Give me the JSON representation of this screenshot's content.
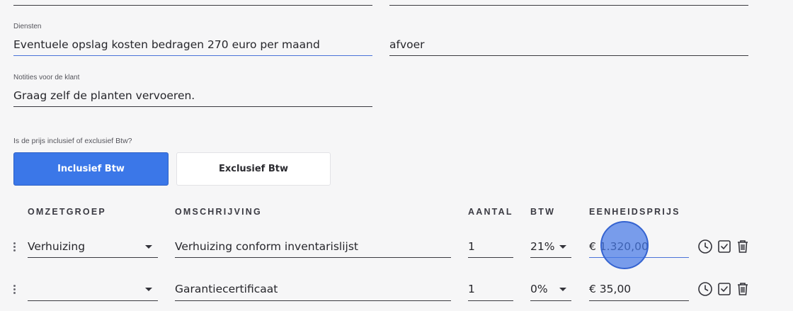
{
  "form": {
    "diensten": {
      "label": "Diensten",
      "value": "Eventuele opslag kosten bedragen 270 euro per maand"
    },
    "second_field": {
      "value": "afvoer"
    },
    "notities": {
      "label": "Notities voor de klant",
      "value": "Graag zelf de planten vervoeren."
    },
    "btw_question": "Is de prijs inclusief of exclusief Btw?",
    "btw_options": [
      "Inclusief Btw",
      "Exclusief Btw"
    ],
    "btw_selected": "Inclusief Btw"
  },
  "table": {
    "headers": [
      "OMZETGROEP",
      "OMSCHRIJVING",
      "AANTAL",
      "BTW",
      "EENHEIDSPRIJS"
    ],
    "rows": [
      {
        "omzetgroep": "Verhuizing",
        "omschrijving": "Verhuizing conform inventarislijst",
        "aantal": "1",
        "btw": "21%",
        "eenheidsprijs": "€ 1.320,00"
      },
      {
        "omzetgroep": "",
        "omschrijving": "Garantiecertificaat",
        "aantal": "1",
        "btw": "0%",
        "eenheidsprijs": "€ 35,00"
      }
    ]
  },
  "icons": [
    "drag-handle-icon",
    "chevron-down-icon",
    "clock-icon",
    "checkbox-icon",
    "trash-icon"
  ],
  "colors": {
    "accent": "#3b77e8",
    "background": "#f6f6f7",
    "cursor_highlight": "#4678e6"
  }
}
